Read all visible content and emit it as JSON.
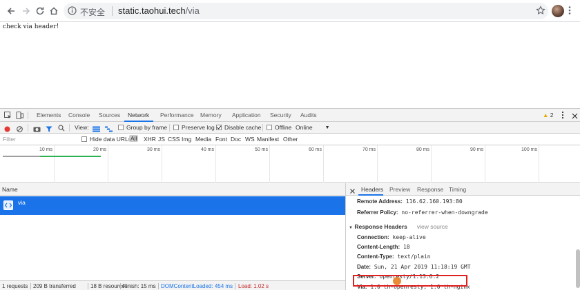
{
  "browser": {
    "security_label": "不安全",
    "url_host": "static.taohui.tech",
    "url_path": "/via"
  },
  "page": {
    "body_text": "check via header!"
  },
  "devtools": {
    "tabs": [
      "Elements",
      "Console",
      "Sources",
      "Network",
      "Performance",
      "Memory",
      "Application",
      "Security",
      "Audits"
    ],
    "active_tab": "Network",
    "warning_count": "2",
    "toolbar": {
      "view_label": "View:",
      "group_by_frame": "Group by frame",
      "preserve_log": "Preserve log",
      "disable_cache": "Disable cache",
      "offline": "Offline",
      "throttle": "Online"
    },
    "filter": {
      "placeholder": "Filter",
      "hide_data_urls": "Hide data URLs",
      "types": [
        "All",
        "XHR",
        "JS",
        "CSS",
        "Img",
        "Media",
        "Font",
        "Doc",
        "WS",
        "Manifest",
        "Other"
      ]
    },
    "timeline_ticks": [
      "10 ms",
      "20 ms",
      "30 ms",
      "40 ms",
      "50 ms",
      "60 ms",
      "70 ms",
      "80 ms",
      "90 ms",
      "100 ms"
    ],
    "list_header": "Name",
    "request": {
      "name": "via"
    },
    "status": {
      "requests": "1 requests",
      "transferred": "209 B transferred",
      "resources": "18 B resources",
      "finish": "Finish: 15 ms",
      "dom_loaded": "DOMContentLoaded: 454 ms",
      "load": "Load: 1.02 s"
    },
    "details": {
      "tabs": [
        "Headers",
        "Preview",
        "Response",
        "Timing"
      ],
      "general": [
        {
          "key": "Remote Address:",
          "value": "116.62.160.193:80"
        },
        {
          "key": "Referrer Policy:",
          "value": "no-referrer-when-downgrade"
        }
      ],
      "response_headers_title": "Response Headers",
      "view_source": "view source",
      "response_headers": [
        {
          "key": "Connection:",
          "value": "keep-alive"
        },
        {
          "key": "Content-Length:",
          "value": "18"
        },
        {
          "key": "Content-Type:",
          "value": "text/plain"
        },
        {
          "key": "Date:",
          "value": "Sun, 21 Apr 2019 11:18:19 GMT"
        },
        {
          "key": "Server:",
          "value": "openresty/1.13.6.2"
        },
        {
          "key": "Via:",
          "value": "1.0 th-openresty, 1.0 th-nginx"
        }
      ]
    }
  },
  "colors": {
    "accent": "#1a73e8",
    "highlight_box": "#e02020",
    "timeline_bar": "#2fb151",
    "record": "#e53935"
  }
}
